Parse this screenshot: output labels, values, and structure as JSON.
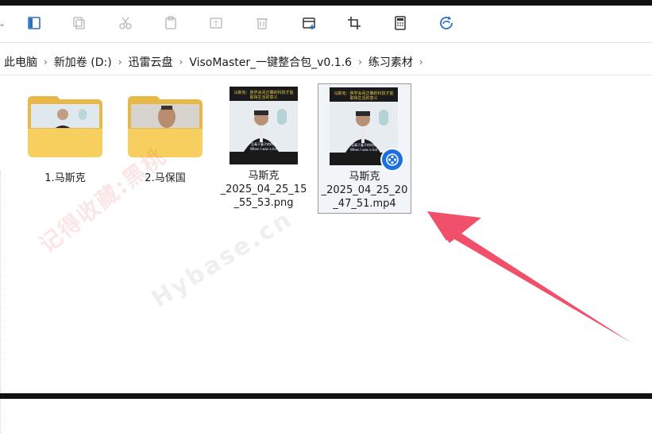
{
  "toolbar": {
    "buttons": [
      {
        "name": "details-pane-icon"
      },
      {
        "name": "copy-icon"
      },
      {
        "name": "cut-icon"
      },
      {
        "name": "paste-icon"
      },
      {
        "name": "rename-icon"
      },
      {
        "name": "delete-icon"
      },
      {
        "name": "new-window-icon"
      },
      {
        "name": "crop-icon"
      },
      {
        "name": "calculator-icon"
      },
      {
        "name": "edge-browser-icon"
      }
    ]
  },
  "breadcrumb": [
    "此电脑",
    "新加卷 (D:)",
    "迅雷云盘",
    "VisoMaster_一键整合包_v0.1.6",
    "练习素材"
  ],
  "files": [
    {
      "type": "folder",
      "label": "1.马斯克"
    },
    {
      "type": "folder",
      "label": "2.马保国"
    },
    {
      "type": "image",
      "label_lines": [
        "马斯克",
        "_2025_04_25_15",
        "_55_53.png"
      ],
      "caption_top": "马斯克：我学会间正确的科技才能取得生活的意义",
      "caption_bot": "至毒于童子的时候",
      "caption_bot2": "When I was a kid"
    },
    {
      "type": "video",
      "label_lines": [
        "马斯克",
        "_2025_04_25_20",
        "_47_51.mp4"
      ],
      "caption_top": "马斯克：我学会间正确的科技才能取得生活的意义",
      "caption_bot": "至毒于童子的时候",
      "caption_bot2": "When I was a kid",
      "selected": true
    }
  ],
  "watermarks": {
    "red": "记得收藏:黑桃",
    "gray": "Hybase.cn"
  },
  "colors": {
    "arrow": "#f0506a",
    "folder": "#f7cf5f",
    "badge": "#1c6fe0"
  }
}
